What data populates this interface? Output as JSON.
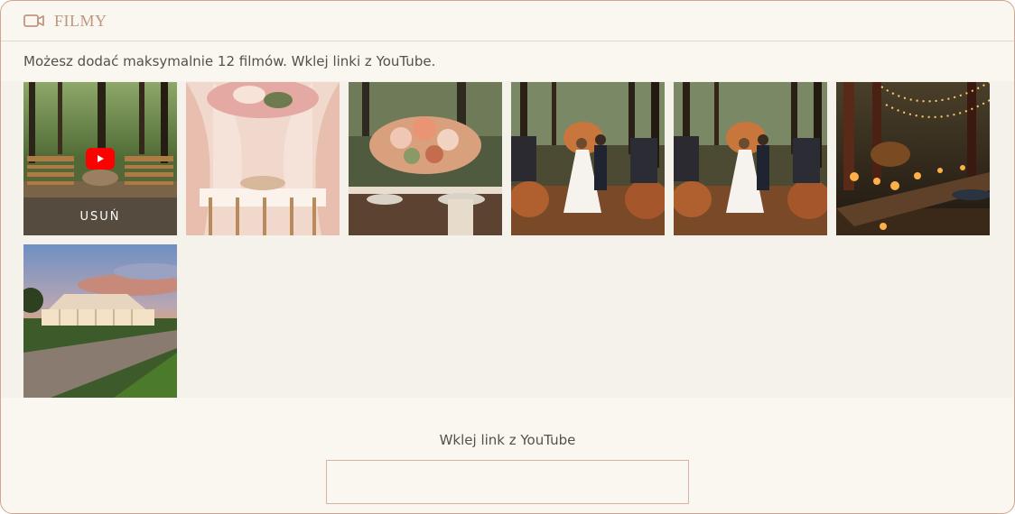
{
  "section": {
    "title": "FILMY",
    "icon": "video-camera-icon",
    "accent_color": "#c09680",
    "border_color": "#d2a58f"
  },
  "hint_text": "Możesz dodać maksymalnie 12 filmów.  Wklej linki z YouTube.",
  "videos": [
    {
      "name": "forest-chairs-ceremony",
      "remove_label": "USUŃ",
      "play_icon": "youtube-play-icon"
    },
    {
      "name": "pink-draped-reception",
      "remove_label": "",
      "play_icon": ""
    },
    {
      "name": "floral-table-setting",
      "remove_label": "",
      "play_icon": ""
    },
    {
      "name": "forest-aisle-couple",
      "remove_label": "",
      "play_icon": ""
    },
    {
      "name": "forest-aisle-couple-2",
      "remove_label": "",
      "play_icon": ""
    },
    {
      "name": "candlelit-forest-dinner",
      "remove_label": "",
      "play_icon": ""
    },
    {
      "name": "glass-tent-sunset",
      "remove_label": "",
      "play_icon": ""
    }
  ],
  "link_input": {
    "label": "Wklej link z YouTube",
    "value": "",
    "placeholder": ""
  }
}
